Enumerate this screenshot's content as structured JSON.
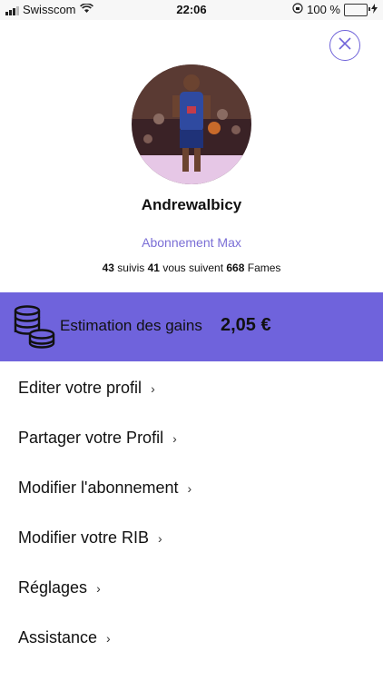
{
  "status": {
    "carrier": "Swisscom",
    "time": "22:06",
    "battery": "100 %"
  },
  "profile": {
    "username": "Andrewalbicy",
    "subscription": "Abonnement Max",
    "stats": {
      "following_count": "43",
      "following_label": "suivis",
      "followers_count": "41",
      "followers_label": "vous suivent",
      "fames_count": "668",
      "fames_label": "Fames"
    }
  },
  "earnings": {
    "label": "Estimation des gains",
    "value": "2,05 €"
  },
  "menu": {
    "items": [
      {
        "label": "Editer votre profil"
      },
      {
        "label": "Partager votre Profil"
      },
      {
        "label": "Modifier l'abonnement"
      },
      {
        "label": "Modifier votre RIB"
      },
      {
        "label": "Réglages"
      },
      {
        "label": "Assistance"
      }
    ]
  },
  "colors": {
    "accent": "#6f63dc",
    "subscription_text": "#7b6fd6"
  }
}
